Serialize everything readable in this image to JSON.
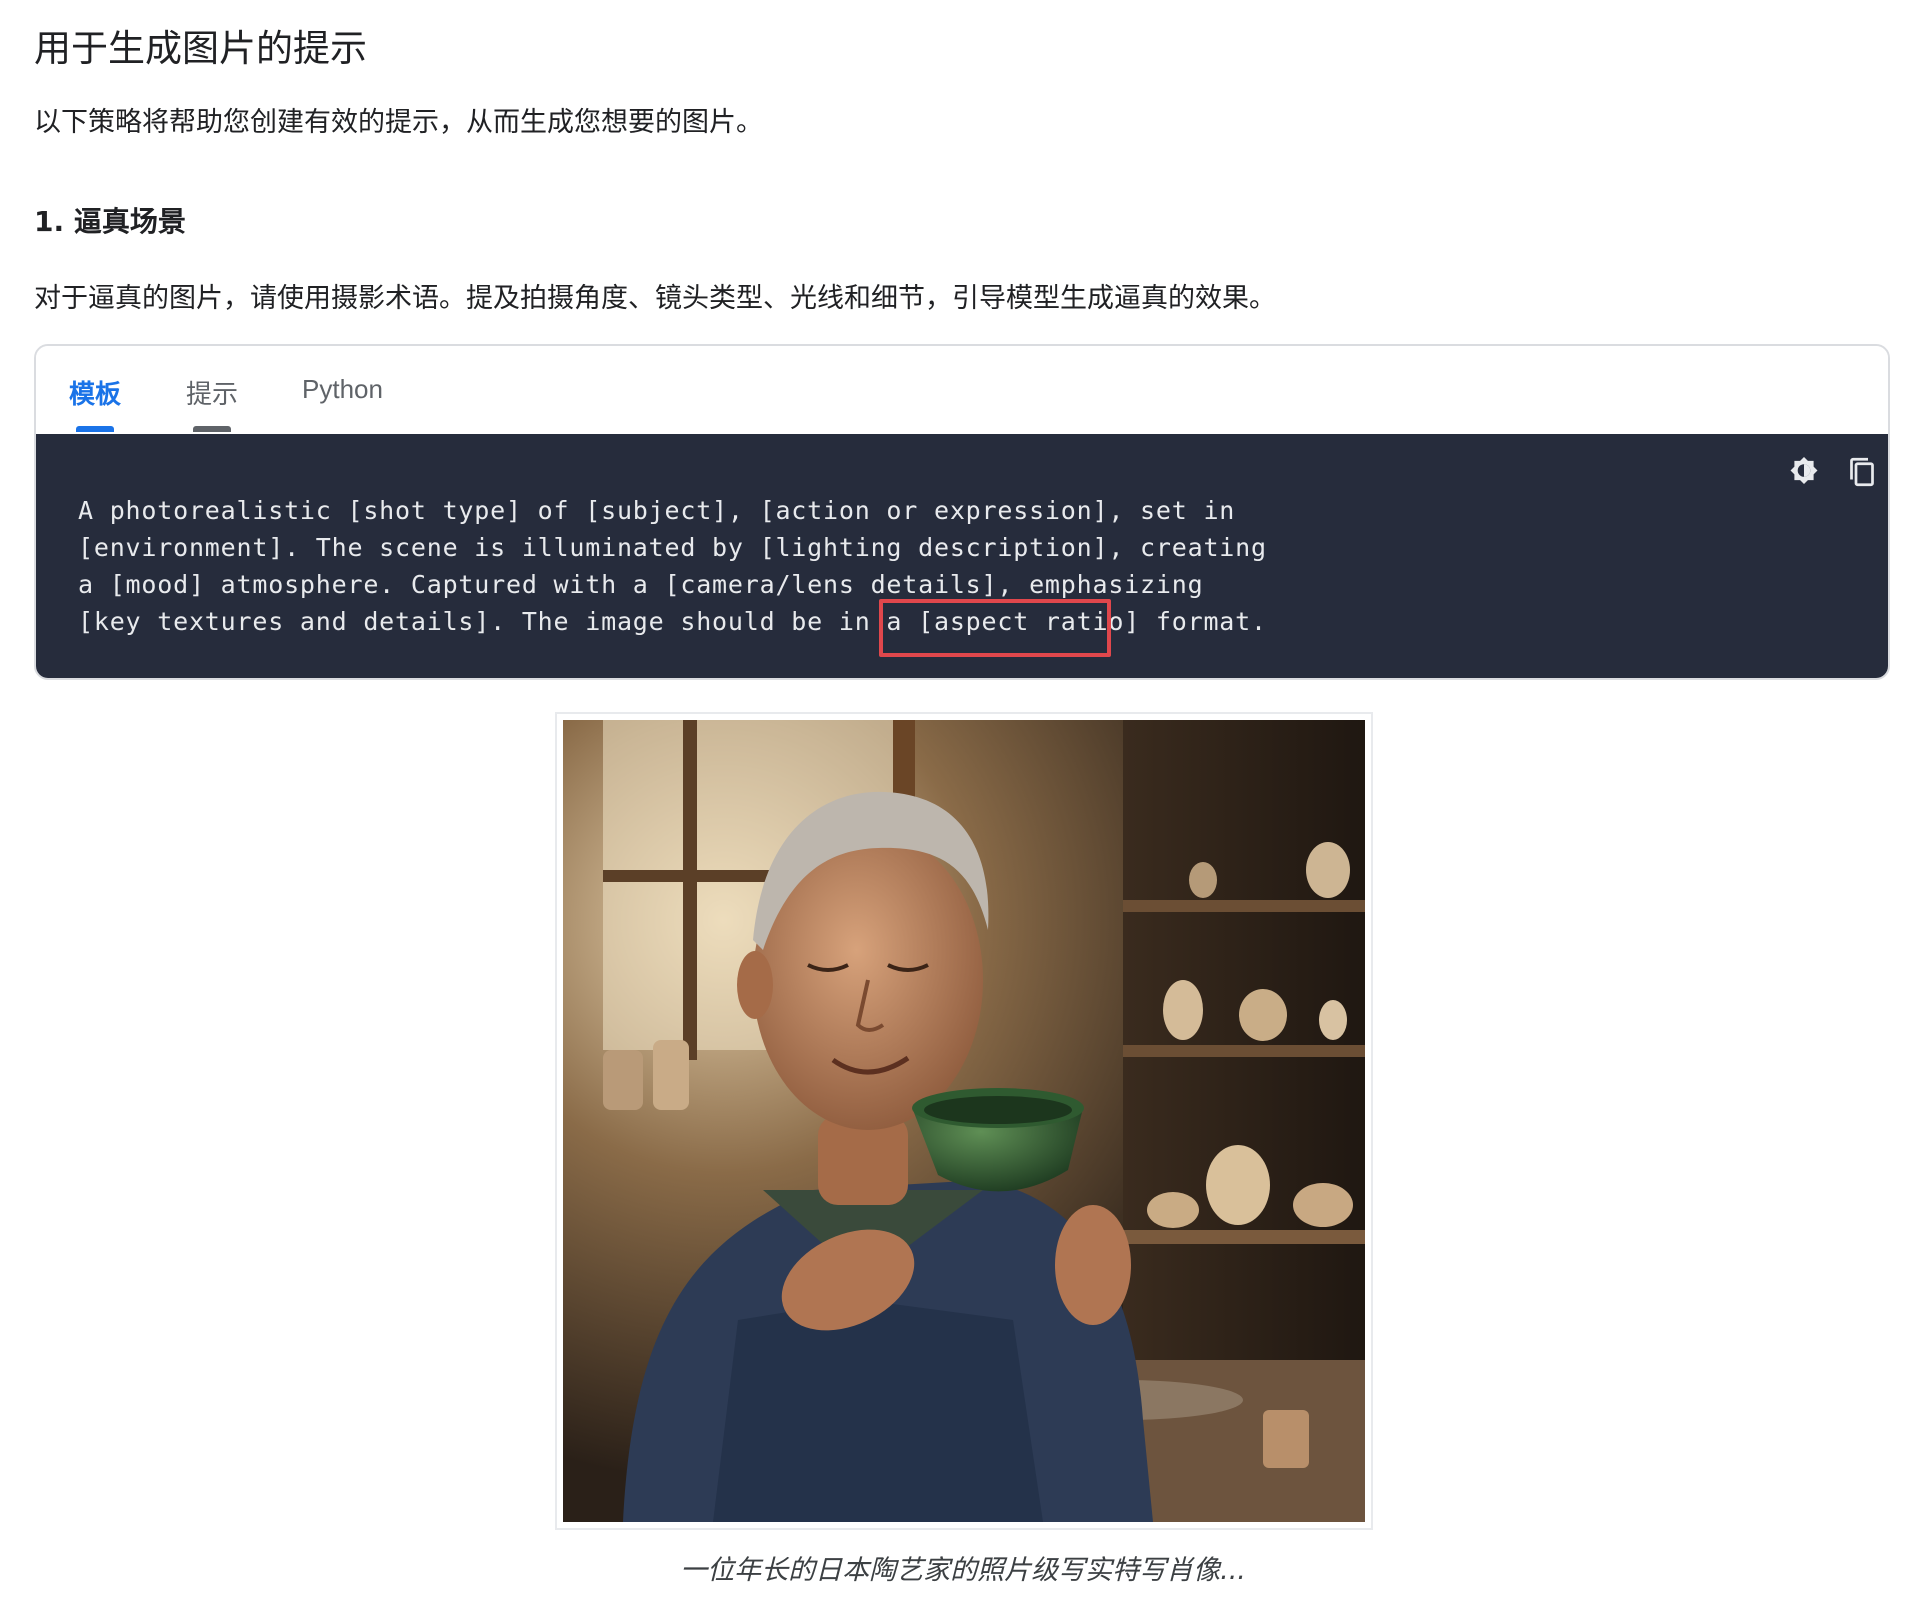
{
  "page": {
    "title": "用于生成图片的提示",
    "intro": "以下策略将帮助您创建有效的提示，从而生成您想要的图片。"
  },
  "section": {
    "heading": "1. 逼真场景",
    "body": "对于逼真的图片，请使用摄影术语。提及拍摄角度、镜头类型、光线和细节，引导模型生成逼真的效果。"
  },
  "code_block": {
    "tabs": [
      {
        "label": "模板",
        "active": true
      },
      {
        "label": "提示",
        "active": false
      },
      {
        "label": "Python",
        "active": false
      }
    ],
    "tools": [
      {
        "name": "theme-toggle",
        "icon": "brightness-icon"
      },
      {
        "name": "copy",
        "icon": "copy-icon"
      }
    ],
    "lines": [
      "A photorealistic [shot type] of [subject], [action or expression], set in",
      "[environment]. The scene is illuminated by [lighting description], creating",
      "a [mood] atmosphere. Captured with a [camera/lens details], emphasizing",
      "[key textures and details]. The image should be in a [aspect ratio] format."
    ],
    "highlighted_phrase": "[aspect ratio]",
    "highlight_color": "#e0474c"
  },
  "figure": {
    "caption": "一位年长的日本陶艺家的照片级写实特写肖像..."
  },
  "colors": {
    "accent": "#1a73e8",
    "code_background": "#262c3c",
    "code_text": "#e8eaed"
  }
}
